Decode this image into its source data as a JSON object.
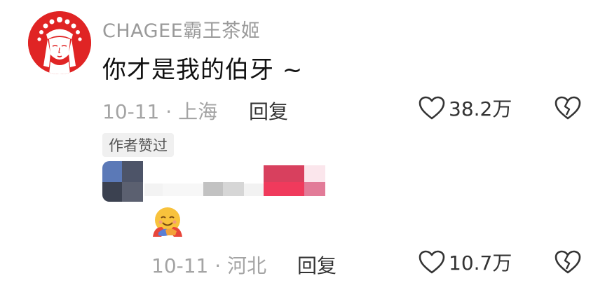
{
  "comment": {
    "author": "CHAGEE霸王茶姬",
    "text": "你才是我的伯牙 ~",
    "date": "10-11",
    "separator": "·",
    "location": "上海",
    "reply_label": "回复",
    "like_count": "38.2万",
    "author_liked_badge": "作者赞过"
  },
  "reply": {
    "author_censored": true,
    "emoji": "smiling-face-with-open-hands-hug",
    "date": "10-11",
    "separator": "·",
    "location": "河北",
    "reply_label": "回复",
    "like_count": "10.7万"
  },
  "colors": {
    "avatar_red": "#e02424",
    "meta_gray": "#a4a4a4",
    "text_dark": "#111111"
  },
  "icons": [
    "heart-outline-icon",
    "broken-heart-icon"
  ]
}
